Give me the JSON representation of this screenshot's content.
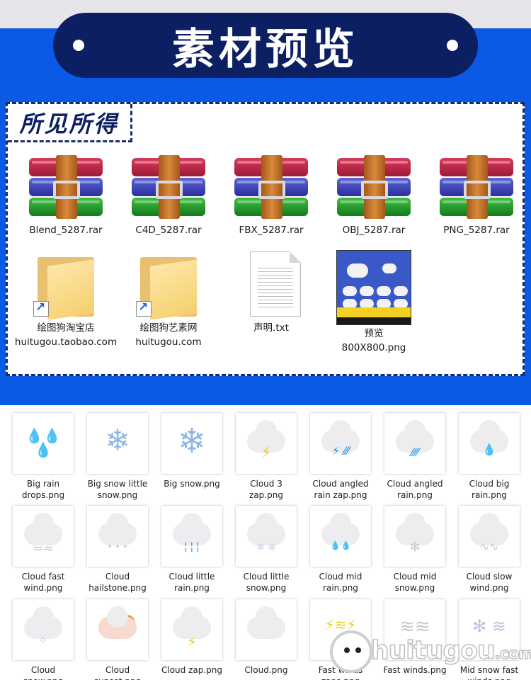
{
  "header": {
    "title": "素材预览"
  },
  "panel": {
    "label": "所见所得",
    "files": [
      {
        "name": "Blend_5287.rar",
        "icon": "rar-archive-icon"
      },
      {
        "name": "C4D_5287.rar",
        "icon": "rar-archive-icon"
      },
      {
        "name": "FBX_5287.rar",
        "icon": "rar-archive-icon"
      },
      {
        "name": "OBJ_5287.rar",
        "icon": "rar-archive-icon"
      },
      {
        "name": "PNG_5287.rar",
        "icon": "rar-archive-icon"
      },
      {
        "name": "绘图狗淘宝店\nhuitugou.taobao.com",
        "icon": "folder-shortcut-icon"
      },
      {
        "name": "绘图狗艺素网\nhuitugou.com",
        "icon": "folder-shortcut-icon"
      },
      {
        "name": "声明.txt",
        "icon": "text-file-icon"
      },
      {
        "name": "预览\n800X800.png",
        "icon": "image-thumbnail-icon"
      }
    ]
  },
  "grid": {
    "items": [
      {
        "label": "Big rain\ndrops.png",
        "icon": "big-rain-drops-icon"
      },
      {
        "label": "Big snow little\nsnow.png",
        "icon": "big-snow-little-snow-icon"
      },
      {
        "label": "Big snow.png",
        "icon": "big-snow-icon"
      },
      {
        "label": "Cloud 3\nzap.png",
        "icon": "cloud-3-zap-icon"
      },
      {
        "label": "Cloud angled\nrain zap.png",
        "icon": "cloud-angled-rain-zap-icon"
      },
      {
        "label": "Cloud angled\nrain.png",
        "icon": "cloud-angled-rain-icon"
      },
      {
        "label": "Cloud big\nrain.png",
        "icon": "cloud-big-rain-icon"
      },
      {
        "label": "Cloud fast\nwind.png",
        "icon": "cloud-fast-wind-icon"
      },
      {
        "label": "Cloud\nhailstone.png",
        "icon": "cloud-hailstone-icon"
      },
      {
        "label": "Cloud little\nrain.png",
        "icon": "cloud-little-rain-icon"
      },
      {
        "label": "Cloud little\nsnow.png",
        "icon": "cloud-little-snow-icon"
      },
      {
        "label": "Cloud mid\nrain.png",
        "icon": "cloud-mid-rain-icon"
      },
      {
        "label": "Cloud mid\nsnow.png",
        "icon": "cloud-mid-snow-icon"
      },
      {
        "label": "Cloud slow\nwind.png",
        "icon": "cloud-slow-wind-icon"
      },
      {
        "label": "Cloud\nsnow.png",
        "icon": "cloud-snow-icon"
      },
      {
        "label": "Cloud\nsunset.png",
        "icon": "cloud-sunset-icon"
      },
      {
        "label": "Cloud zap.png",
        "icon": "cloud-zap-icon"
      },
      {
        "label": "Cloud.png",
        "icon": "cloud-icon"
      },
      {
        "label": "Fast winds\nzaps.png",
        "icon": "fast-winds-zaps-icon"
      },
      {
        "label": "Fast winds.png",
        "icon": "fast-winds-icon"
      },
      {
        "label": "Mid snow fast\nwinds.png",
        "icon": "mid-snow-fast-winds-icon"
      }
    ]
  },
  "watermark": {
    "text": "huitugou",
    "suffix": ".com"
  },
  "colors": {
    "banner_blue": "#0a5ae6",
    "pill_navy": "#0b1f62",
    "rain_blue": "#1f8fe0",
    "zap_yellow": "#f5d020"
  }
}
